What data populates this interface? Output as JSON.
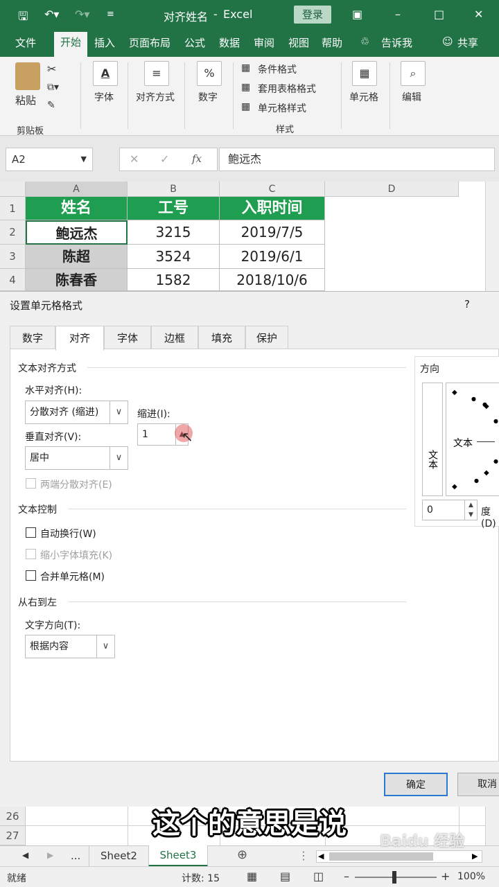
{
  "title_bar": {
    "doc_name": "对齐姓名",
    "separator": "-",
    "app_name": "Excel",
    "login_label": "登录"
  },
  "ribbon_tabs": [
    "文件",
    "开始",
    "插入",
    "页面布局",
    "公式",
    "数据",
    "审阅",
    "视图",
    "帮助",
    "告诉我",
    "共享"
  ],
  "ribbon": {
    "paste": "粘贴",
    "clipboard": "剪贴板",
    "font": "字体",
    "alignment": "对齐方式",
    "number": "数字",
    "percent_symbol": "%",
    "cond_format": "条件格式",
    "table_format": "套用表格格式",
    "cell_style": "单元格样式",
    "styles": "样式",
    "cells": "单元格",
    "editing": "编辑"
  },
  "formula_bar": {
    "name_box": "A2",
    "fx": "fx",
    "formula": "鲍远杰"
  },
  "grid": {
    "columns": [
      "A",
      "B",
      "C",
      "D"
    ],
    "rows": [
      "1",
      "2",
      "3",
      "4"
    ],
    "header": [
      "姓名",
      "工号",
      "入职时间"
    ],
    "data": [
      [
        "鲍远杰",
        "3215",
        "2019/7/5"
      ],
      [
        "陈超",
        "3524",
        "2019/6/1"
      ],
      [
        "陈春香",
        "1582",
        "2018/10/6"
      ]
    ],
    "lower_rows": [
      "26",
      "27"
    ]
  },
  "dialog": {
    "title": "设置单元格格式",
    "help": "?",
    "tabs": [
      "数字",
      "对齐",
      "字体",
      "边框",
      "填充",
      "保护"
    ],
    "text_align_section": "文本对齐方式",
    "horizontal_label": "水平对齐(H):",
    "horizontal_value": "分散对齐 (缩进)",
    "indent_label": "缩进(I):",
    "indent_value": "1",
    "vertical_label": "垂直对齐(V):",
    "vertical_value": "居中",
    "justify_distributed": "两端分散对齐(E)",
    "text_control_section": "文本控制",
    "wrap_text": "自动换行(W)",
    "shrink_to_fit": "缩小字体填充(K)",
    "merge_cells": "合并单元格(M)",
    "rtl_section": "从右到左",
    "text_direction_label": "文字方向(T):",
    "text_direction_value": "根据内容",
    "orientation_section": "方向",
    "vertical_text": "文本",
    "orientation_text": "文本",
    "degree_value": "0",
    "degree_label": "度(D)",
    "ok": "确定",
    "cancel": "取消"
  },
  "sheets": {
    "ellipsis": "...",
    "tabs": [
      "Sheet2",
      "Sheet3"
    ],
    "active": "Sheet3"
  },
  "status": {
    "ready": "就绪",
    "count": "计数: 15",
    "zoom": "100%"
  },
  "subtitle": "这个的意思是说",
  "watermark": "Baidu 经验",
  "colors": {
    "excel_green": "#217346",
    "header_fill": "#1f9d50",
    "selected_fill": "#d0d0d0"
  }
}
